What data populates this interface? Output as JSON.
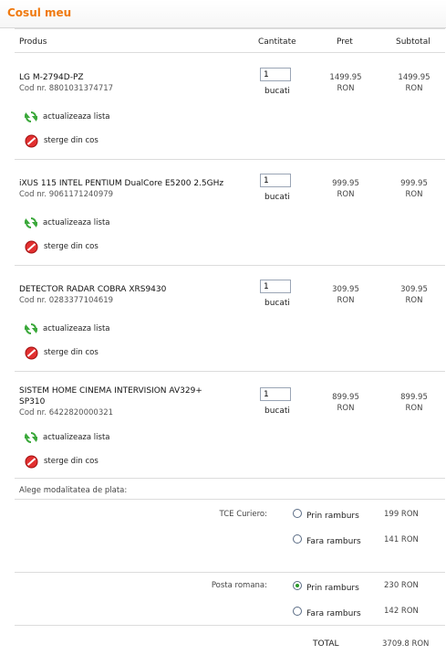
{
  "title": "Cosul meu",
  "headers": {
    "product": "Produs",
    "qty": "Cantitate",
    "price": "Pret",
    "subtotal": "Subtotal"
  },
  "actions": {
    "update": "actualizeaza lista",
    "delete": "sterge din cos"
  },
  "unit": "bucati",
  "currency": "RON",
  "items": [
    {
      "name": "LG M-2794D-PZ",
      "code": "Cod nr. 8801031374717",
      "qty": "1",
      "price": "1499.95",
      "subtotal": "1499.95"
    },
    {
      "name": "iXUS 115 INTEL PENTIUM DualCore E5200 2.5GHz",
      "code": "Cod nr. 9061171240979",
      "qty": "1",
      "price": "999.95",
      "subtotal": "999.95"
    },
    {
      "name": "DETECTOR RADAR COBRA XRS9430",
      "code": "Cod nr. 0283377104619",
      "qty": "1",
      "price": "309.95",
      "subtotal": "309.95"
    },
    {
      "name": "SISTEM HOME CINEMA INTERVISION AV329+ SP310",
      "code": "Cod nr. 6422820000321",
      "qty": "1",
      "price": "899.95",
      "subtotal": "899.95"
    }
  ],
  "payment": {
    "heading": "Alege modalitatea de plata:",
    "carriers": [
      {
        "name": "TCE Curiero:",
        "options": [
          {
            "label": "Prin ramburs",
            "price": "199 RON",
            "selected": false
          },
          {
            "label": "Fara ramburs",
            "price": "141 RON",
            "selected": false
          }
        ]
      },
      {
        "name": "Posta romana:",
        "options": [
          {
            "label": "Prin ramburs",
            "price": "230 RON",
            "selected": true
          },
          {
            "label": "Fara ramburs",
            "price": "142 RON",
            "selected": false
          }
        ]
      }
    ]
  },
  "total": {
    "label": "TOTAL",
    "value": "3709.8 RON"
  },
  "colors": {
    "accent": "#f07a10",
    "update_icon": "#3aa83a",
    "delete_icon": "#d92020"
  },
  "icons": {
    "update": "refresh-icon",
    "delete": "delete-icon"
  }
}
